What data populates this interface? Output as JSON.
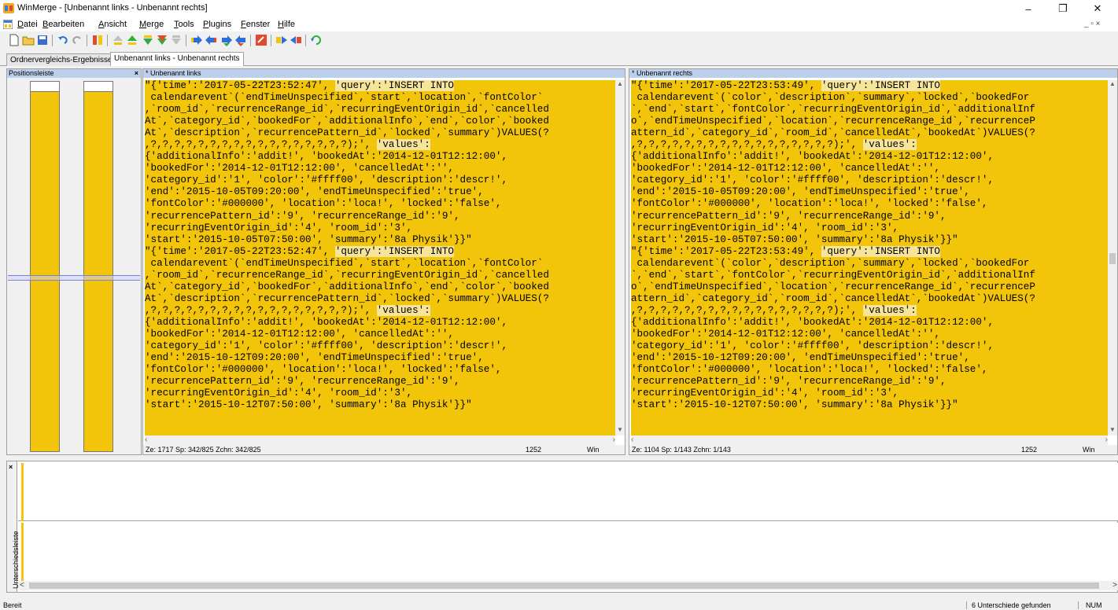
{
  "window": {
    "title": "WinMerge - [Unbenannt links - Unbenannt rechts]",
    "minimize": "–",
    "maximize": "❐",
    "close": "✕"
  },
  "menu": {
    "items": [
      {
        "label": "Datei",
        "u": "D",
        "rest": "atei"
      },
      {
        "label": "Bearbeiten",
        "u": "B",
        "rest": "earbeiten"
      },
      {
        "label": "Ansicht",
        "u": "A",
        "rest": "nsicht"
      },
      {
        "label": "Merge",
        "u": "M",
        "rest": "erge"
      },
      {
        "label": "Tools",
        "u": "T",
        "rest": "ools"
      },
      {
        "label": "Plugins",
        "u": "P",
        "rest": "lugins"
      },
      {
        "label": "Fenster",
        "u": "F",
        "rest": "enster"
      },
      {
        "label": "Hilfe",
        "u": "H",
        "rest": "ilfe"
      }
    ],
    "mdi_controls": "_ ▫ ×"
  },
  "toolbar": {
    "icons": [
      "new-file-icon",
      "open-folder-icon",
      "save-icon",
      "undo-icon",
      "redo-icon",
      "merge-block-icon",
      "first-diff-icon",
      "last-diff-icon",
      "prev-conflict-icon",
      "next-conflict-icon",
      "all-diffs-icon",
      "copy-right-icon",
      "copy-left-icon",
      "copy-right-advance-icon",
      "copy-left-advance-icon",
      "options-icon",
      "view-diff-right-icon",
      "view-diff-left-icon",
      "refresh-icon"
    ]
  },
  "tabs": [
    {
      "label": "Ordnervergleichs-Ergebnisse",
      "active": false
    },
    {
      "label": "Unbenannt links - Unbenannt rechts",
      "active": true
    }
  ],
  "location_pane": {
    "title": "Positionsleiste",
    "close": "×"
  },
  "left_pane": {
    "title": "* Unbenannt links",
    "lines": [
      [
        "\"{'time':'2017-05-22T23:52:47', ",
        "'query':'INSERT INTO"
      ],
      [
        " calendarevent`(`endTimeUnspecified`,`start`,`location`,`fontColor`"
      ],
      [
        ",`room_id`,`recurrenceRange_id`,`recurringEventOrigin_id`,`cancelled"
      ],
      [
        "At`,`category_id`,`bookedFor`,`additionalInfo`,`end`,`color`,`booked"
      ],
      [
        "At`,`description`,`recurrencePattern_id`,`locked`,`summary`)VALUES(?"
      ],
      [
        ",?,?,?,?,?,?,?,?,?,?,?,?,?,?,?,?,?);', ",
        "'values':"
      ],
      [
        "{'additionalInfo':'addit!', 'bookedAt':'2014-12-01T12:12:00',"
      ],
      [
        "'bookedFor':'2014-12-01T12:12:00', 'cancelledAt':'',"
      ],
      [
        "'category_id':'1', 'color':'#ffff00', 'description':'descr!',"
      ],
      [
        "'end':'2015-10-05T09:20:00', 'endTimeUnspecified':'true',"
      ],
      [
        "'fontColor':'#000000', 'location':'loca!', 'locked':'false',"
      ],
      [
        "'recurrencePattern_id':'9', 'recurrenceRange_id':'9',"
      ],
      [
        "'recurringEventOrigin_id':'4', 'room_id':'3',"
      ],
      [
        "'start':'2015-10-05T07:50:00', 'summary':'8a Physik'}}\""
      ],
      [
        "\"{'time':'2017-05-22T23:52:47', ",
        "'query':'INSERT INTO"
      ],
      [
        " calendarevent`(`endTimeUnspecified`,`start`,`location`,`fontColor`"
      ],
      [
        ",`room_id`,`recurrenceRange_id`,`recurringEventOrigin_id`,`cancelled"
      ],
      [
        "At`,`category_id`,`bookedFor`,`additionalInfo`,`end`,`color`,`booked"
      ],
      [
        "At`,`description`,`recurrencePattern_id`,`locked`,`summary`)VALUES(?"
      ],
      [
        ",?,?,?,?,?,?,?,?,?,?,?,?,?,?,?,?,?);', ",
        "'values':"
      ],
      [
        "{'additionalInfo':'addit!', 'bookedAt':'2014-12-01T12:12:00',"
      ],
      [
        "'bookedFor':'2014-12-01T12:12:00', 'cancelledAt':'',"
      ],
      [
        "'category_id':'1', 'color':'#ffff00', 'description':'descr!',"
      ],
      [
        "'end':'2015-10-12T09:20:00', 'endTimeUnspecified':'true',"
      ],
      [
        "'fontColor':'#000000', 'location':'loca!', 'locked':'false',"
      ],
      [
        "'recurrencePattern_id':'9', 'recurrenceRange_id':'9',"
      ],
      [
        "'recurringEventOrigin_id':'4', 'room_id':'3',"
      ],
      [
        "'start':'2015-10-12T07:50:00', 'summary':'8a Physik'}}\""
      ]
    ],
    "status": {
      "position": "Ze: 1717  Sp: 342/825  Zchn: 342/825",
      "codepage": "1252",
      "eol": "Win"
    }
  },
  "right_pane": {
    "title": "* Unbenannt rechts",
    "lines": [
      [
        "\"{'time':'2017-05-22T23:53:49', ",
        "'query':'INSERT INTO"
      ],
      [
        " calendarevent`(`color`,`description`,`summary`,`locked`,`bookedFor"
      ],
      [
        "`,`end`,`start`,`fontColor`,`recurringEventOrigin_id`,`additionalInf"
      ],
      [
        "o`,`endTimeUnspecified`,`location`,`recurrenceRange_id`,`recurrenceP"
      ],
      [
        "attern_id`,`category_id`,`room_id`,`cancelledAt`,`bookedAt`)VALUES(?"
      ],
      [
        ",?,?,?,?,?,?,?,?,?,?,?,?,?,?,?,?,?);', ",
        "'values':"
      ],
      [
        "{'additionalInfo':'addit!', 'bookedAt':'2014-12-01T12:12:00',"
      ],
      [
        "'bookedFor':'2014-12-01T12:12:00', 'cancelledAt':'',"
      ],
      [
        "'category_id':'1', 'color':'#ffff00', 'description':'descr!',"
      ],
      [
        "'end':'2015-10-05T09:20:00', 'endTimeUnspecified':'true',"
      ],
      [
        "'fontColor':'#000000', 'location':'loca!', 'locked':'false',"
      ],
      [
        "'recurrencePattern_id':'9', 'recurrenceRange_id':'9',"
      ],
      [
        "'recurringEventOrigin_id':'4', 'room_id':'3',"
      ],
      [
        "'start':'2015-10-05T07:50:00', 'summary':'8a Physik'}}\""
      ],
      [
        "\"{'time':'2017-05-22T23:53:49', ",
        "'query':'INSERT INTO"
      ],
      [
        " calendarevent`(`color`,`description`,`summary`,`locked`,`bookedFor"
      ],
      [
        "`,`end`,`start`,`fontColor`,`recurringEventOrigin_id`,`additionalInf"
      ],
      [
        "o`,`endTimeUnspecified`,`location`,`recurrenceRange_id`,`recurrenceP"
      ],
      [
        "attern_id`,`category_id`,`room_id`,`cancelledAt`,`bookedAt`)VALUES(?"
      ],
      [
        ",?,?,?,?,?,?,?,?,?,?,?,?,?,?,?,?,?);', ",
        "'values':"
      ],
      [
        "{'additionalInfo':'addit!', 'bookedAt':'2014-12-01T12:12:00',"
      ],
      [
        "'bookedFor':'2014-12-01T12:12:00', 'cancelledAt':'',"
      ],
      [
        "'category_id':'1', 'color':'#ffff00', 'description':'descr!',"
      ],
      [
        "'end':'2015-10-12T09:20:00', 'endTimeUnspecified':'true',"
      ],
      [
        "'fontColor':'#000000', 'location':'loca!', 'locked':'false',"
      ],
      [
        "'recurrencePattern_id':'9', 'recurrenceRange_id':'9',"
      ],
      [
        "'recurringEventOrigin_id':'4', 'room_id':'3',"
      ],
      [
        "'start':'2015-10-12T07:50:00', 'summary':'8a Physik'}}\""
      ]
    ],
    "status": {
      "position": "Ze: 1104  Sp: 1/143  Zchn: 1/143",
      "codepage": "1252",
      "eol": "Win"
    }
  },
  "diff_pane": {
    "title": "Unterschiedsleiste",
    "close": "×",
    "scroll_left": "<",
    "scroll_right": ">"
  },
  "statusbar": {
    "ready": "Bereit",
    "diffs": "6 Unterschiede gefunden",
    "num": "NUM"
  },
  "colors": {
    "diff_block": "#f2c50a",
    "word_diff": "#f6e49a",
    "pane_header": "#bcd0ec"
  }
}
